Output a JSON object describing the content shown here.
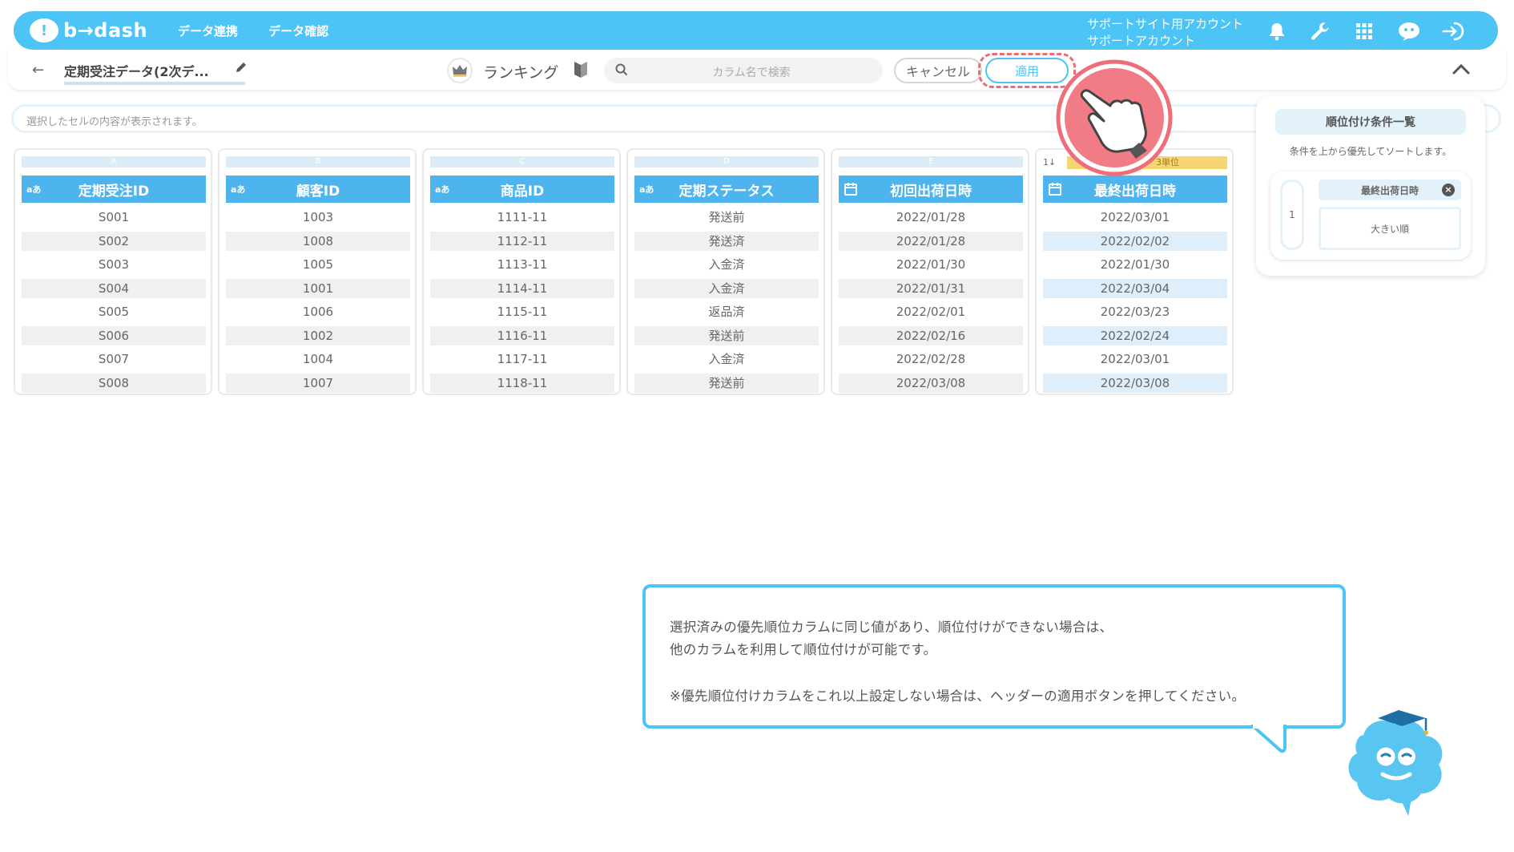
{
  "brand": {
    "name": "b→dash",
    "accent": "#4cc4f5",
    "header_blue": "#4db4ee"
  },
  "nav": [
    "データ連携",
    "データ確認"
  ],
  "account": {
    "line1": "サポートサイト用アカウント",
    "line2": "サポートアカウント"
  },
  "toolbar": {
    "dataset_name": "定期受注データ(2次デ...",
    "mode_label": "ランキング",
    "search_placeholder": "カラム名で検索",
    "cancel_label": "キャンセル",
    "apply_label": "適用"
  },
  "cell_preview_placeholder": "選択したセルの内容が表示されます。",
  "columns": [
    {
      "letter": "A",
      "name": "定期受注ID",
      "type": "text",
      "type_tag": "aあ",
      "rows": [
        "S001",
        "S002",
        "S003",
        "S004",
        "S005",
        "S006",
        "S007",
        "S008"
      ]
    },
    {
      "letter": "B",
      "name": "顧客ID",
      "type": "text",
      "type_tag": "aあ",
      "rows": [
        "1003",
        "1008",
        "1005",
        "1001",
        "1006",
        "1002",
        "1004",
        "1007"
      ]
    },
    {
      "letter": "C",
      "name": "商品ID",
      "type": "text",
      "type_tag": "aあ",
      "rows": [
        "1111-11",
        "1112-11",
        "1113-11",
        "1114-11",
        "1115-11",
        "1116-11",
        "1117-11",
        "1118-11"
      ]
    },
    {
      "letter": "D",
      "name": "定期ステータス",
      "type": "text",
      "type_tag": "aあ",
      "rows": [
        "発送前",
        "発送済",
        "入金済",
        "入金済",
        "返品済",
        "発送前",
        "入金済",
        "発送前"
      ]
    },
    {
      "letter": "E",
      "name": "初回出荷日時",
      "type": "date",
      "rows": [
        "2022/01/28",
        "2022/01/28",
        "2022/01/30",
        "2022/01/31",
        "2022/02/01",
        "2022/02/16",
        "2022/02/28",
        "2022/03/08"
      ]
    },
    {
      "letter": "F",
      "name": "最終出荷日時",
      "type": "date",
      "sort_tag": "1↓",
      "unit_tag": "3単位",
      "rows": [
        "2022/03/01",
        "2022/02/02",
        "2022/01/30",
        "2022/03/04",
        "2022/03/23",
        "2022/02/24",
        "2022/03/01",
        "2022/03/08"
      ]
    }
  ],
  "ranking_panel": {
    "title": "順位付け条件一覧",
    "description": "条件を上から優先してソートします。",
    "items": [
      {
        "priority": "1",
        "column": "最終出荷日時",
        "order": "大きい順"
      }
    ]
  },
  "tip": {
    "line1": "選択済みの優先順位カラムに同じ値があり、順位付けができない場合は、",
    "line2": "他のカラムを利用して順位付けが可能です。",
    "line3": "※優先順位付けカラムをこれ以上設定しない場合は、ヘッダーの適用ボタンを押してください。"
  }
}
